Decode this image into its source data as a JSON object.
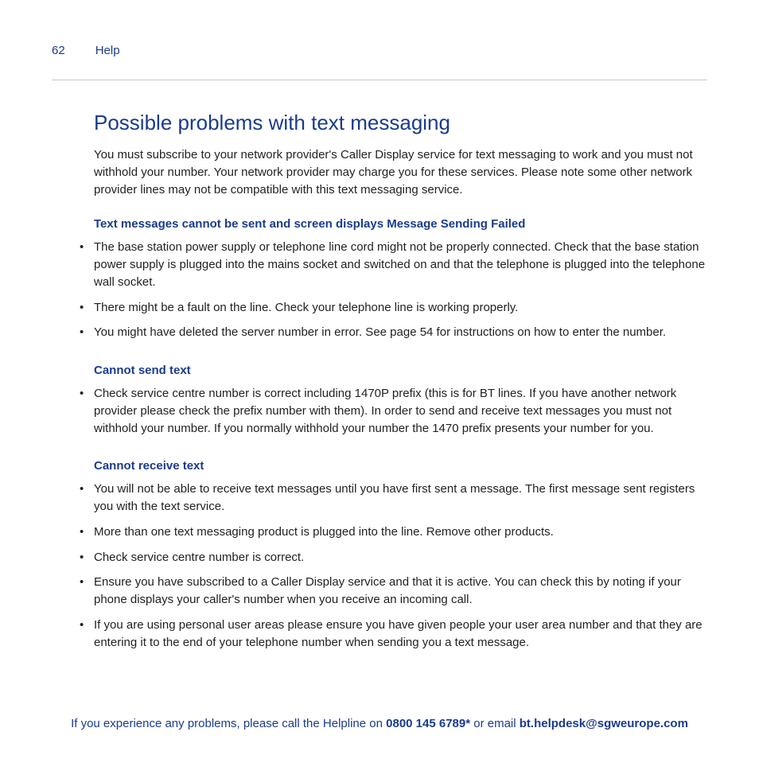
{
  "header": {
    "page_number": "62",
    "section": "Help"
  },
  "title": "Possible problems with text messaging",
  "intro": "You must subscribe to your network provider's Caller Display service for text messaging to work and you must not withhold your number. Your network provider may charge you for these services. Please note some other network provider lines may not be compatible with this text messaging service.",
  "sections": [
    {
      "heading": "Text messages cannot be sent and screen displays Message Sending Failed",
      "items": [
        "The base station power supply or telephone line cord might not be properly connected. Check that the base station power supply is plugged into the mains socket and switched on and that the telephone is plugged into the telephone wall socket.",
        "There might be a fault on the line. Check your telephone line is working properly.",
        "You might have deleted the server number in error. See page 54 for instructions on how to enter the number."
      ]
    },
    {
      "heading": "Cannot send text",
      "items": [
        "Check service centre number is correct including 1470P prefix (this is for BT lines. If you have another network provider please check the prefix number with them). In order to send and receive text messages you must not withhold your number. If you normally withhold your number the 1470 prefix presents your number for you."
      ]
    },
    {
      "heading": "Cannot receive text",
      "items": [
        "You will not be able to receive text messages until you have first sent a message. The first message sent registers you with the text service.",
        "More than one text messaging product is plugged into the line. Remove other products.",
        "Check service centre number is correct.",
        "Ensure you have subscribed to a Caller Display service and that it is active. You can check this by noting if your phone displays your caller's number when you receive an incoming call.",
        "If you are using personal user areas please ensure you have given people your user area number and that they are entering it to the end of your telephone number when sending you a text message."
      ]
    }
  ],
  "footer": {
    "pre": "If you experience any problems, please call the Helpline on ",
    "phone": "0800 145 6789*",
    "mid": " or email ",
    "email": "bt.helpdesk@sgweurope.com"
  }
}
